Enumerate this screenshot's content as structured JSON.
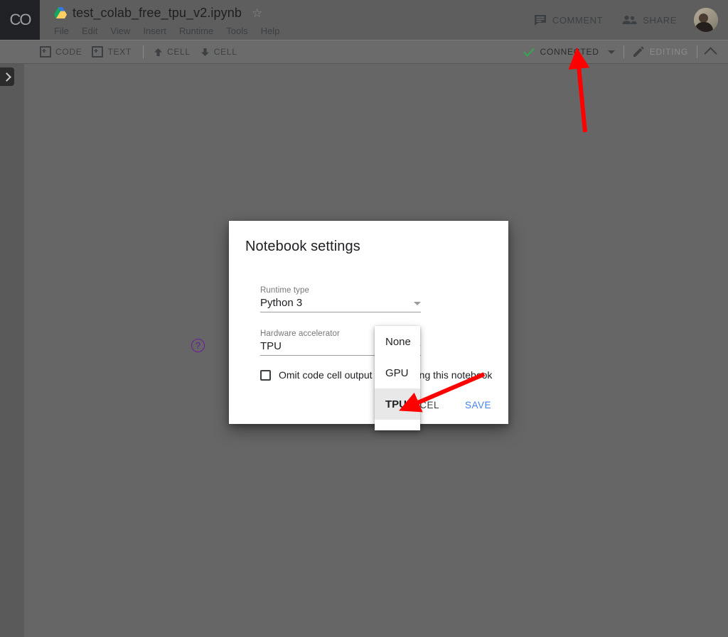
{
  "header": {
    "logo_text": "CO",
    "doc_title": "test_colab_free_tpu_v2.ipynb",
    "star_glyph": "☆",
    "menu_items": [
      {
        "label": "File"
      },
      {
        "label": "Edit"
      },
      {
        "label": "View"
      },
      {
        "label": "Insert"
      },
      {
        "label": "Runtime"
      },
      {
        "label": "Tools"
      },
      {
        "label": "Help"
      }
    ],
    "comment_label": "COMMENT",
    "share_label": "SHARE"
  },
  "toolbar": {
    "add_code_label": "CODE",
    "add_text_label": "TEXT",
    "cell_up_label": "CELL",
    "cell_down_label": "CELL",
    "connected_label": "CONNECTED",
    "editing_label": "EDITING"
  },
  "dialog": {
    "title": "Notebook settings",
    "runtime_type": {
      "label": "Runtime type",
      "value": "Python 3"
    },
    "hardware_accelerator": {
      "label": "Hardware accelerator",
      "value": "TPU",
      "options": [
        {
          "label": "None",
          "selected": false
        },
        {
          "label": "GPU",
          "selected": false
        },
        {
          "label": "TPU",
          "selected": true
        }
      ]
    },
    "help_glyph": "?",
    "omit_output_label": "Omit code cell output when saving this notebook",
    "cancel_label": "CANCEL",
    "save_label": "SAVE"
  },
  "colors": {
    "scrim": "#666666",
    "rail": "#5a5a5a",
    "header_bar": "#5e5e5e",
    "toolbar_bar": "#6b6b6b",
    "accent_save": "#4285f4",
    "help_purple": "#6a1b9a",
    "connected_check": "#34a853",
    "annotation_red": "#ff0000",
    "dropdown_selected_bg": "#e8e8e8"
  }
}
